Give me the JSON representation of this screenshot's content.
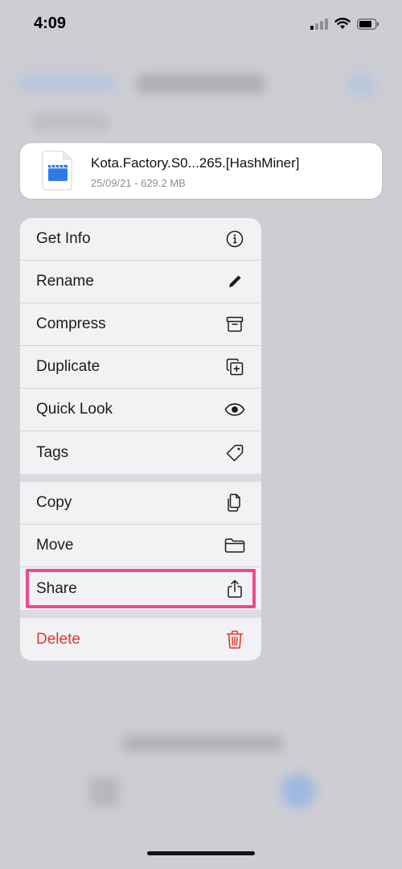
{
  "status_bar": {
    "time": "4:09"
  },
  "preview": {
    "file_name": "Kota.Factory.S0...265.[HashMiner]",
    "file_meta": "25/09/21 - 629.2 MB",
    "file_icon": "video-file-icon"
  },
  "menu": {
    "groups": [
      {
        "items": [
          {
            "label": "Get Info",
            "icon": "info-icon"
          },
          {
            "label": "Rename",
            "icon": "pencil-icon"
          },
          {
            "label": "Compress",
            "icon": "archive-box-icon"
          },
          {
            "label": "Duplicate",
            "icon": "duplicate-icon"
          },
          {
            "label": "Quick Look",
            "icon": "eye-icon"
          },
          {
            "label": "Tags",
            "icon": "tag-icon"
          }
        ]
      },
      {
        "items": [
          {
            "label": "Copy",
            "icon": "copy-icon"
          },
          {
            "label": "Move",
            "icon": "folder-icon"
          },
          {
            "label": "Share",
            "icon": "share-icon",
            "highlighted": true
          }
        ]
      },
      {
        "items": [
          {
            "label": "Delete",
            "icon": "trash-icon",
            "destructive": true
          }
        ]
      }
    ]
  },
  "colors": {
    "destructive": "#e5352b",
    "highlight_border": "#ee4a8d",
    "file_icon_blue": "#2f7be6"
  }
}
